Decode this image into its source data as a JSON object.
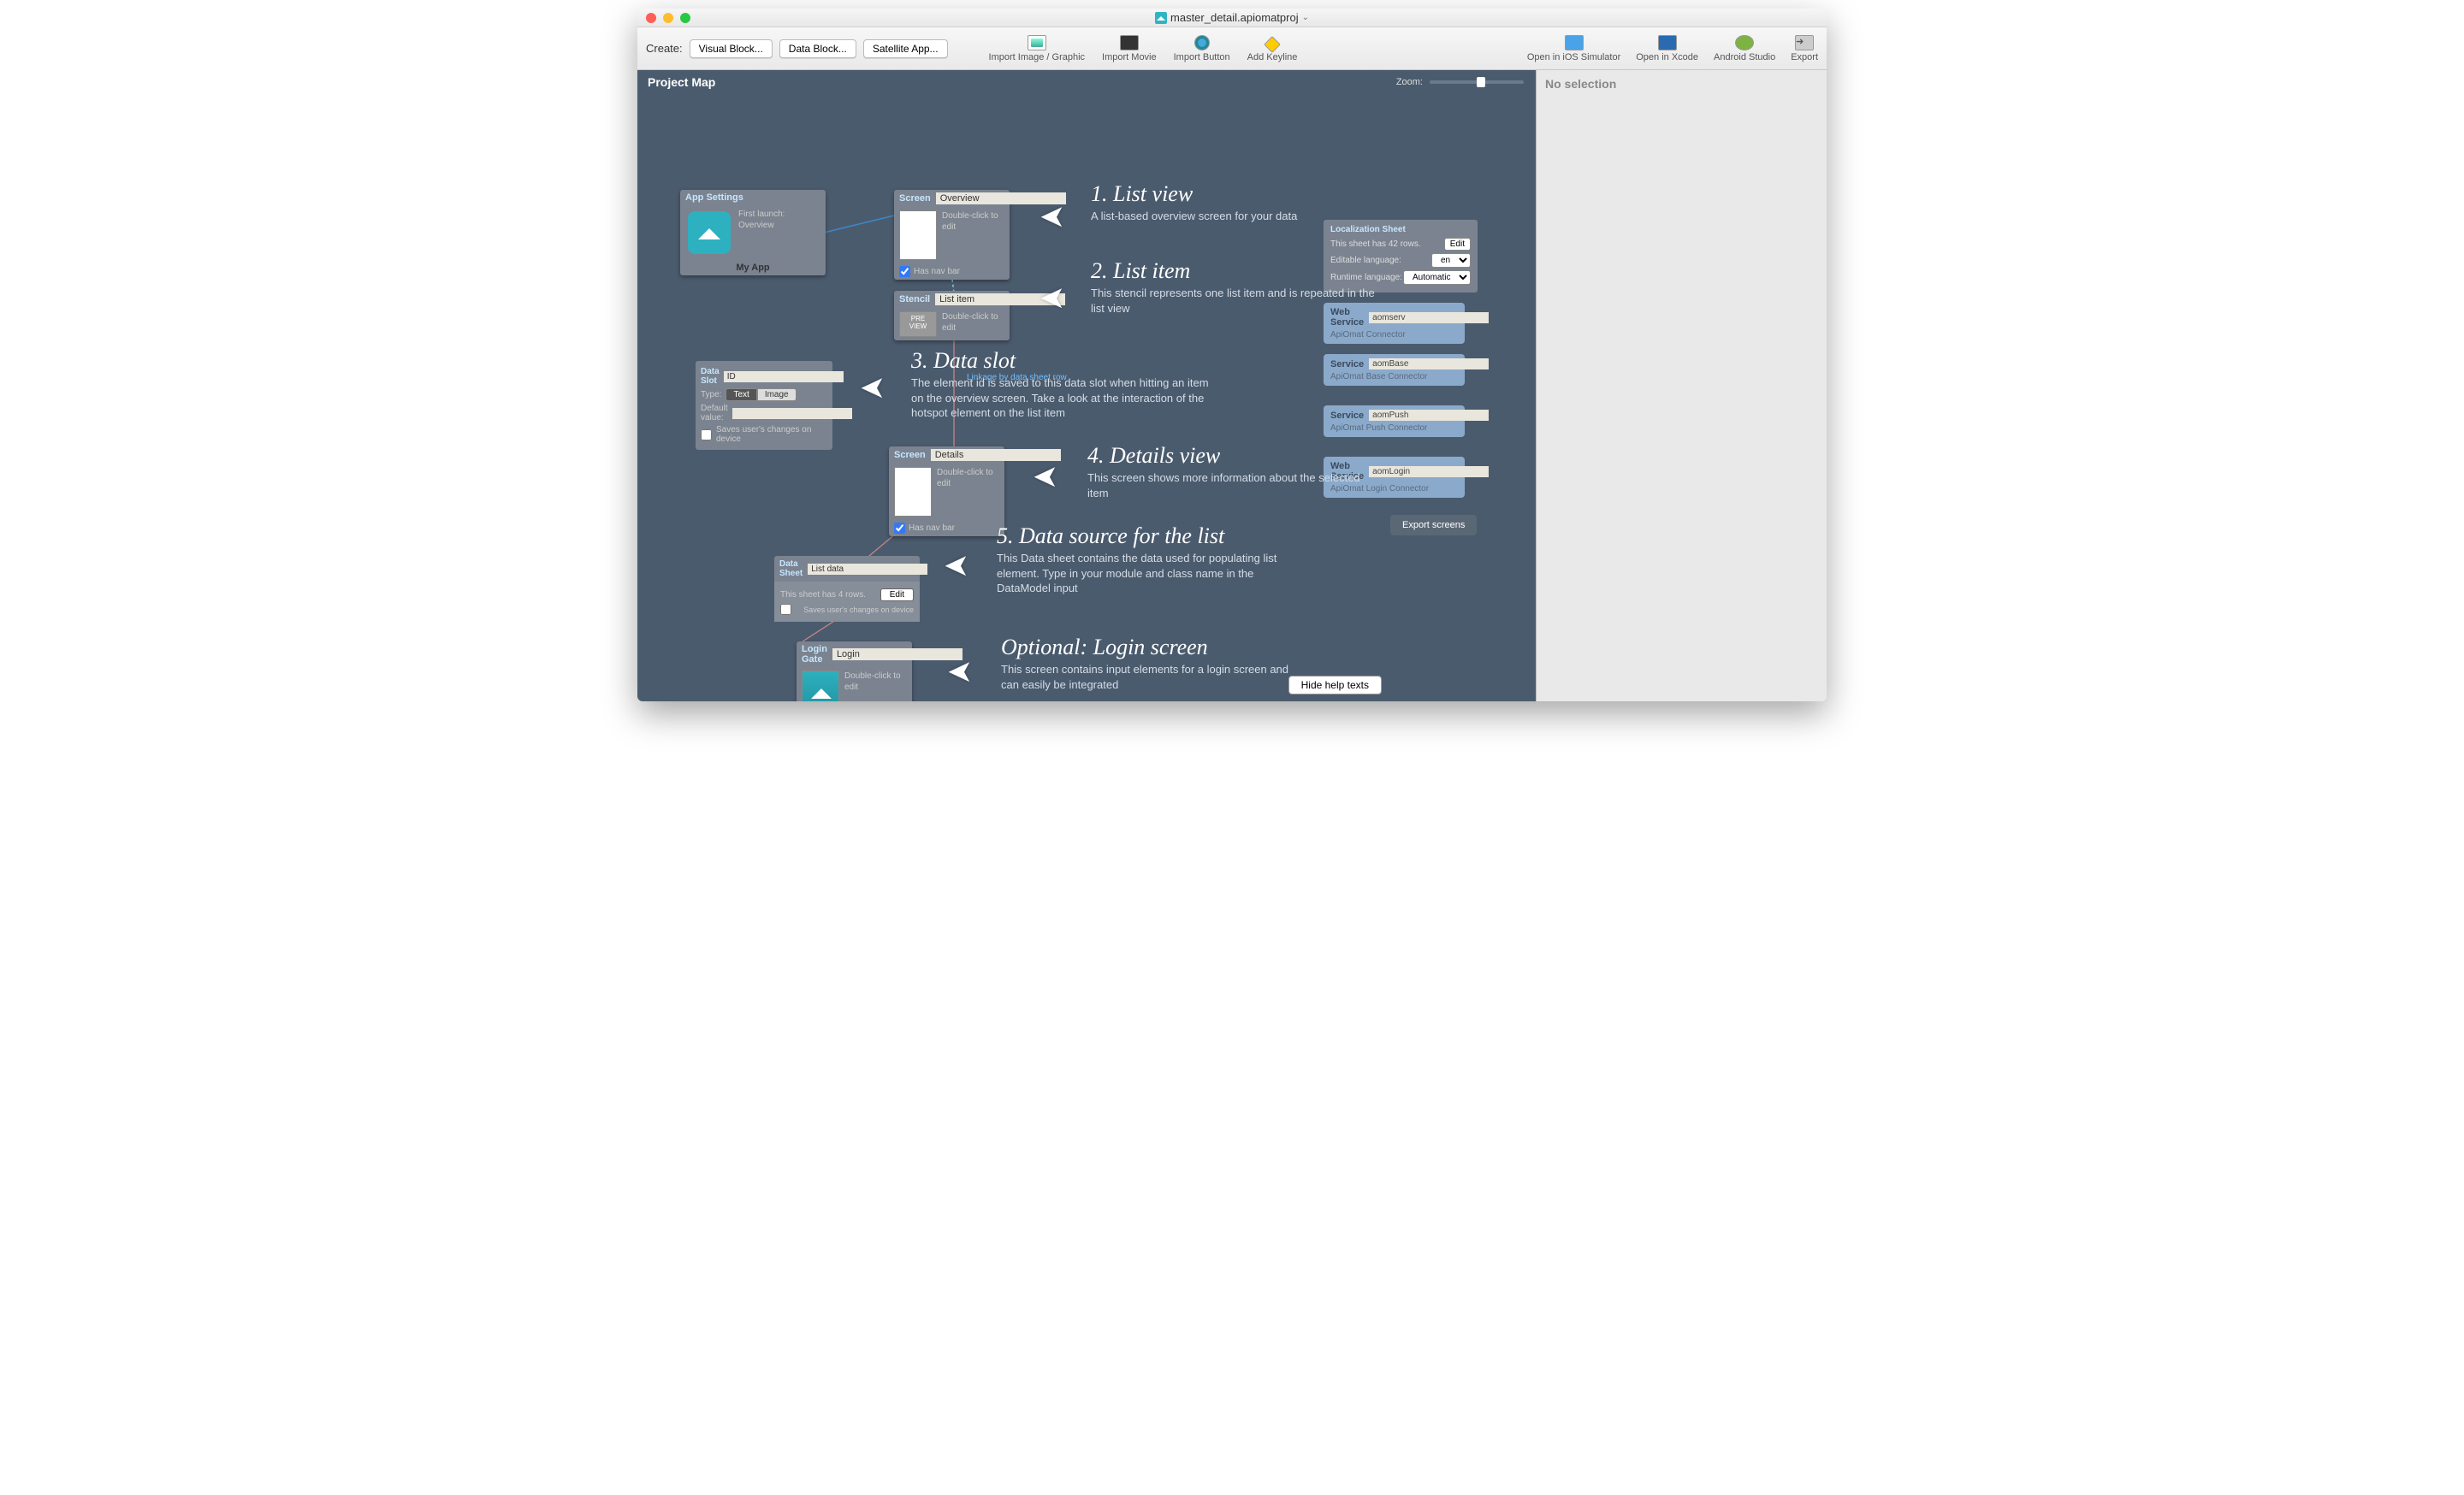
{
  "window": {
    "title": "master_detail.apiomatproj"
  },
  "toolbar": {
    "create_label": "Create:",
    "buttons": [
      "Visual Block...",
      "Data Block...",
      "Satellite App..."
    ],
    "tools": [
      {
        "label": "Import Image / Graphic",
        "icon": "img"
      },
      {
        "label": "Import Movie",
        "icon": "mov"
      },
      {
        "label": "Import Button",
        "icon": "btn"
      },
      {
        "label": "Add Keyline",
        "icon": "key"
      }
    ],
    "right": [
      "Open in iOS Simulator",
      "Open in Xcode",
      "Android Studio",
      "Export"
    ]
  },
  "canvas": {
    "title": "Project Map",
    "zoom_label": "Zoom:",
    "hide_help": "Hide help texts",
    "export_screens": "Export screens",
    "linkage_text": "Linkage by data sheet row"
  },
  "sidepanel": {
    "title": "No selection"
  },
  "nodes": {
    "appsettings": {
      "hdr": "App Settings",
      "first_launch": "First launch:",
      "first_launch_val": "Overview",
      "app_name": "My App"
    },
    "screen1": {
      "hdr": "Screen",
      "name": "Overview",
      "desc": "Double-click to edit",
      "nav": "Has nav bar"
    },
    "stencil": {
      "hdr": "Stencil",
      "name": "List item",
      "desc": "Double-click to edit"
    },
    "dataslot": {
      "hdr": "Data Slot",
      "name": "ID",
      "type_label": "Type:",
      "seg": [
        "Text",
        "Image"
      ],
      "default_label": "Default value:",
      "save": "Saves user's changes on device"
    },
    "screen2": {
      "hdr": "Screen",
      "name": "Details",
      "desc": "Double-click to edit",
      "nav": "Has nav bar"
    },
    "datasheet": {
      "hdr": "Data Sheet",
      "name": "List data",
      "rows": "This sheet has 4 rows.",
      "edit": "Edit",
      "save": "Saves user's changes on device"
    },
    "login": {
      "hdr": "Login Gate",
      "name": "Login",
      "desc": "Double-click to edit"
    }
  },
  "loc": {
    "hdr": "Localization Sheet",
    "rows": "This sheet has 42 rows.",
    "edit": "Edit",
    "lang_label": "Editable language:",
    "lang_val": "en",
    "runtime_label": "Runtime language:",
    "runtime_val": "Automatic"
  },
  "services": [
    {
      "type": "Web Service",
      "name": "aomserv",
      "sub": "ApiOmat Connector"
    },
    {
      "type": "Service",
      "name": "aomBase",
      "sub": "ApiOmat Base Connector"
    },
    {
      "type": "Service",
      "name": "aomPush",
      "sub": "ApiOmat Push Connector"
    },
    {
      "type": "Web Service",
      "name": "aomLogin",
      "sub": "ApiOmat Login Connector"
    }
  ],
  "ann": [
    {
      "title": "1. List view",
      "body": "A list-based overview screen for your data"
    },
    {
      "title": "2. List item",
      "body": "This stencil represents one list item and is repeated in the list view"
    },
    {
      "title": "3. Data slot",
      "body": "The element id is saved to this data slot when hitting an item on the overview screen. Take a look at the interaction of the hotspot element on the list item"
    },
    {
      "title": "4. Details view",
      "body": "This screen shows more information about the selected item"
    },
    {
      "title": "5. Data source for the list",
      "body": "This Data sheet contains the data used for populating list element. Type in your module and class name in the DataModel input"
    },
    {
      "title": "Optional: Login screen",
      "body": "This screen contains input elements for a login screen and can easily be integrated"
    }
  ]
}
